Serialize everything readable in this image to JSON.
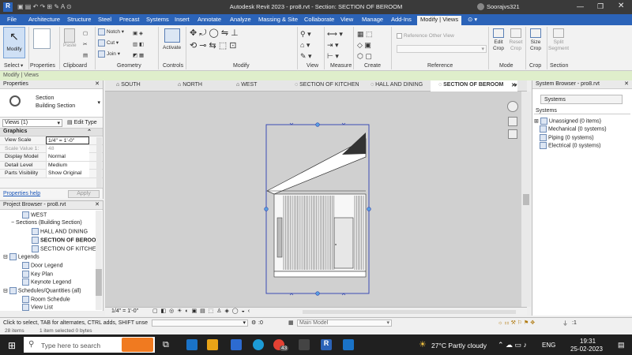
{
  "titlebar": {
    "title": "Autodesk Revit 2023 - pro8.rvt - Section: SECTION OF BEROOM",
    "user": "Soorajvs321"
  },
  "menu_tabs": [
    "File",
    "Architecture",
    "Structure",
    "Steel",
    "Precast",
    "Systems",
    "Insert",
    "Annotate",
    "Analyze",
    "Massing & Site",
    "Collaborate",
    "View",
    "Manage",
    "Add-Ins",
    "Modify | Views"
  ],
  "ribbon": {
    "modify": "Modify",
    "paste": "Paste",
    "notch": "Notch",
    "cut": "Cut",
    "join": "Join",
    "activate": "Activate",
    "reference_other_view": "Reference Other View",
    "edit_crop": "Edit Crop",
    "reset_crop": "Reset Crop",
    "size_crop": "Size Crop",
    "split_segment": "Split Segment",
    "panels": {
      "select": "Select",
      "properties": "Properties",
      "clipboard": "Clipboard",
      "geometry": "Geometry",
      "controls": "Controls",
      "modify": "Modify",
      "view": "View",
      "measure": "Measure",
      "create": "Create",
      "reference": "Reference",
      "mode": "Mode",
      "crop": "Crop",
      "section": "Section"
    }
  },
  "context_bar": "Modify | Views",
  "properties": {
    "title": "Properties",
    "type_line1": "Section",
    "type_line2": "Building Section",
    "selector": "Views (1)",
    "edit_type": "Edit Type",
    "group": "Graphics",
    "rows": [
      {
        "k": "View Scale",
        "v": "1/4\" = 1'-0\""
      },
      {
        "k": "Scale Value  1:",
        "v": "48"
      },
      {
        "k": "Display Model",
        "v": "Normal"
      },
      {
        "k": "Detail Level",
        "v": "Medium"
      },
      {
        "k": "Parts Visibility",
        "v": "Show Original"
      }
    ],
    "help": "Properties help",
    "apply": "Apply"
  },
  "project_browser": {
    "title": "Project Browser - pro8.rvt",
    "items": [
      "WEST",
      "Sections (Building Section)",
      "HALL AND DINING",
      "SECTION OF BEROOM",
      "SECTION OF KITCHEN",
      "Legends",
      "Door Legend",
      "Key Plan",
      "Keynote Legend",
      "Schedules/Quantities (all)",
      "Room Schedule",
      "View List"
    ]
  },
  "view_tabs": [
    "SOUTH",
    "NORTH",
    "WEST",
    "SECTION OF KITCHEN",
    "HALL AND DINING",
    "SECTION OF BEROOM"
  ],
  "view_control": {
    "scale": "1/4\" = 1'-0\""
  },
  "system_browser": {
    "title": "System Browser - pro8.rvt",
    "dropdown": "Systems",
    "header": "Systems",
    "items": [
      "Unassigned (0 items)",
      "Mechanical (0 systems)",
      "Piping (0 systems)",
      "Electrical (0 systems)"
    ]
  },
  "status": {
    "hint": "Click to select, TAB for alternates, CTRL adds, SHIFT unse",
    "zero": ":0",
    "model": "Main Model",
    "filter": ":1"
  },
  "infobar": {
    "items": "28 items",
    "selected": "1 item selected  0 bytes"
  },
  "taskbar": {
    "search": "Type here to search",
    "badge": "43",
    "weather": "27°C  Partly cloudy",
    "lang": "ENG",
    "time": "19:31",
    "date": "25-02-2023"
  }
}
